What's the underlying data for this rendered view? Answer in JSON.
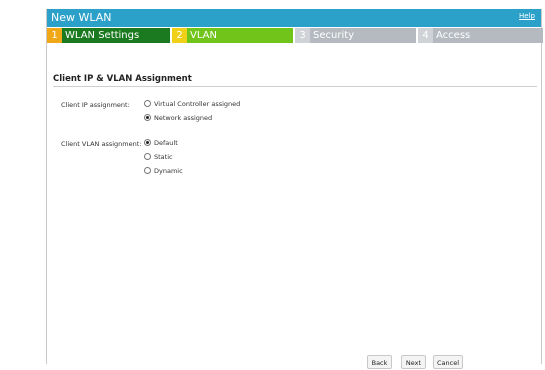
{
  "window": {
    "title": "New WLAN",
    "help_label": "Help",
    "header_color": "#2ba0c8"
  },
  "steps": [
    {
      "number": "1",
      "label": "WLAN Settings",
      "state": "completed"
    },
    {
      "number": "2",
      "label": "VLAN",
      "state": "current"
    },
    {
      "number": "3",
      "label": "Security",
      "state": "pending"
    },
    {
      "number": "4",
      "label": "Access",
      "state": "pending"
    }
  ],
  "section": {
    "title": "Client IP & VLAN Assignment"
  },
  "client_ip": {
    "label": "Client IP assignment:",
    "options": [
      {
        "label": "Virtual Controller assigned",
        "selected": false
      },
      {
        "label": "Network assigned",
        "selected": true
      }
    ]
  },
  "client_vlan": {
    "label": "Client VLAN assignment:",
    "options": [
      {
        "label": "Default",
        "selected": true
      },
      {
        "label": "Static",
        "selected": false
      },
      {
        "label": "Dynamic",
        "selected": false
      }
    ]
  },
  "footer": {
    "back_label": "Back",
    "next_label": "Next",
    "cancel_label": "Cancel"
  }
}
